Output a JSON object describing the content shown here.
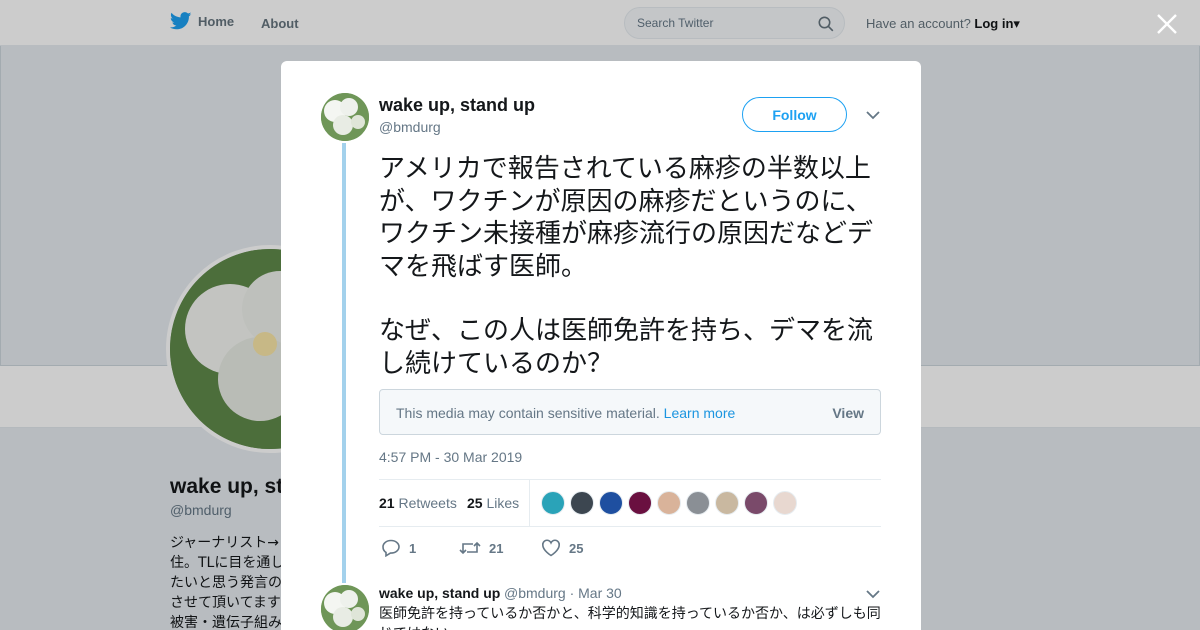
{
  "nav": {
    "home_label": "Home",
    "about_label": "About",
    "search_placeholder": "Search Twitter",
    "account_prompt": "Have an account?",
    "login_label": "Log in"
  },
  "profile_bg": {
    "name": "wake up, stand up",
    "handle": "@bmdurg",
    "bio_lines": [
      "ジャーナリスト→",
      "住。TLに目を通し",
      "たいと思う発言の",
      "させて頂いてます",
      "被害・遺伝子組み"
    ]
  },
  "tweet": {
    "author_name": "wake up, stand up",
    "author_handle": "@bmdurg",
    "follow_label": "Follow",
    "text_p1": "アメリカで報告されている麻疹の半数以上が、ワクチンが原因の麻疹だというのに、ワクチン未接種が麻疹流行の原因だなどデマを飛ばす医師。",
    "text_p2": "なぜ、この人は医師免許を持ち、デマを流し続けているのか？",
    "sensitive_msg": "This media may contain sensitive material.",
    "learn_more": "Learn more",
    "view_label": "View",
    "timestamp": "4:57 PM - 30 Mar 2019",
    "retweets_count": "21",
    "retweets_label": "Retweets",
    "likes_count": "25",
    "likes_label": "Likes",
    "reply_count": "1",
    "retweet_action_count": "21",
    "like_action_count": "25",
    "liker_colors": [
      "#2aa3b8",
      "#3c4650",
      "#1e4fa0",
      "#6a1040",
      "#d9b39a",
      "#8a8f95",
      "#c9b8a0",
      "#7a4a6a",
      "#e8d8d0"
    ]
  },
  "reply": {
    "author_name": "wake up, stand up",
    "meta": "@bmdurg · Mar 30",
    "text": "医師免許を持っているか否かと、科学的知識を持っているか否か、は必ずしも同じではない。"
  },
  "colors": {
    "accent": "#1da1f2",
    "thread": "#a3d1ec",
    "link": "#1b95e0"
  }
}
